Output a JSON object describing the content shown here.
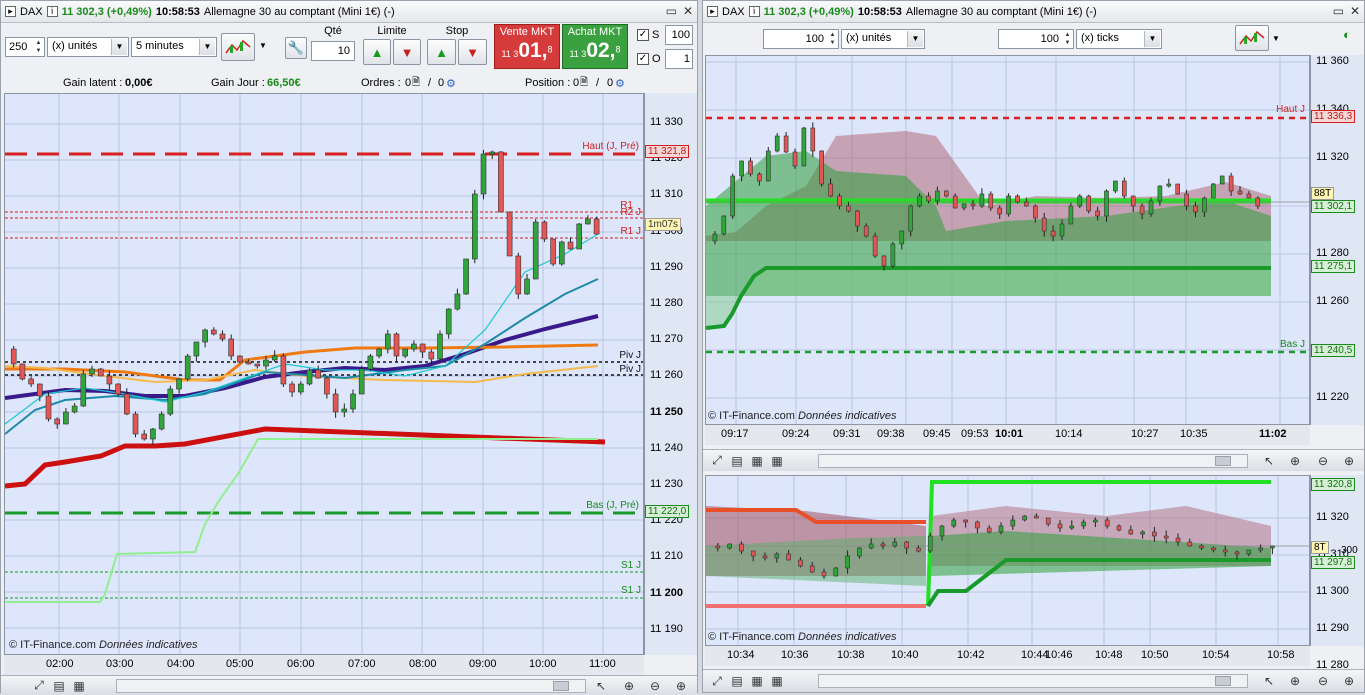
{
  "left": {
    "title": {
      "symbol": "DAX",
      "quote": "11 302,3 (+0,49%)",
      "time": "10:58:53",
      "instrument": "Allemagne 30 au comptant (Mini 1€) (-)"
    },
    "toolbar": {
      "qty_value": "250",
      "units_label": "(x) unités",
      "timeframe": "5 minutes",
      "qte_label": "Qté",
      "qte_value": "10",
      "limite_label": "Limite",
      "stop_label": "Stop",
      "vente_label": "Vente MKT",
      "vente_prefix": "11 3",
      "vente_big": "01,",
      "vente_sup": "8",
      "achat_label": "Achat MKT",
      "achat_prefix": "11 3",
      "achat_big": "02,",
      "achat_sup": "8",
      "s_label": "S",
      "s_value": "100",
      "o_label": "O",
      "o_value": "1"
    },
    "info": {
      "gain_latent_label": "Gain latent :",
      "gain_latent_value": "0,00€",
      "gain_jour_label": "Gain Jour :",
      "gain_jour_value": "66,50€",
      "ordres_label": "Ordres :",
      "ordres_a": "0",
      "ordres_b": "0",
      "position_label": "Position :",
      "position_a": "0",
      "position_b": "0"
    },
    "yaxis": [
      "11 330",
      "11 320",
      "11 310",
      "11 300",
      "11 290",
      "11 280",
      "11 270",
      "11 260",
      "11 250",
      "11 240",
      "11 230",
      "11 220",
      "11 210",
      "11 200",
      "11 190"
    ],
    "yaxis_bold": [
      "11 250",
      "11 200"
    ],
    "xaxis": [
      "02:00",
      "03:00",
      "04:00",
      "05:00",
      "06:00",
      "07:00",
      "08:00",
      "09:00",
      "10:00",
      "11:00"
    ],
    "levels": {
      "haut": "Haut (J, Pré)",
      "haut_price": "11 321,8",
      "r1a": "R1",
      "r2": "R2 J",
      "r1j": "R1 J",
      "countdown": "1m07s",
      "piv1": "Piv J",
      "piv2": "Piv J",
      "bas": "Bas (J, Pré)",
      "bas_price": "11 222,0",
      "s1a": "S1 J",
      "s1b": "S1 J"
    },
    "copyright": "© IT-Finance.com",
    "copyright_note": "Données indicatives"
  },
  "right": {
    "title": {
      "symbol": "DAX",
      "quote": "11 302,3 (+0,49%)",
      "time": "10:58:53",
      "instrument": "Allemagne 30 au comptant (Mini 1€) (-)"
    },
    "toolbar": {
      "qty1": "100",
      "units1": "(x) unités",
      "qty2": "100",
      "units2": "(x) ticks"
    },
    "top_chart": {
      "yaxis": [
        "11 360",
        "11 340",
        "11 320",
        "11 300",
        "11 280",
        "11 260",
        "11 240",
        "11 220"
      ],
      "xaxis": [
        "09:17",
        "09:24",
        "09:31",
        "09:38",
        "09:45",
        "09:53",
        "10:01",
        "10:14",
        "10:27",
        "10:35",
        "11:02"
      ],
      "xaxis_bold": [
        "10:01",
        "11:02"
      ],
      "haut": "Haut J",
      "haut_price": "11 336,3",
      "tag": "88T",
      "current_price": "11 302,1",
      "support_price": "11 275,1",
      "bas": "Bas J",
      "bas_price": "11 240,5"
    },
    "bottom_chart": {
      "yaxis": [
        "11 320",
        "11 310",
        "11 300",
        "11 290",
        "11 280"
      ],
      "xaxis": [
        "10:34",
        "10:36",
        "10:38",
        "10:40",
        "10:42",
        "10:44",
        "10:46",
        "10:48",
        "10:50",
        "10:54",
        "10:58"
      ],
      "top_price": "11 320,8",
      "tag": "8T",
      "current_partial": "300",
      "bottom_price": "11 297,8"
    },
    "copyright": "© IT-Finance.com",
    "copyright_note": "Données indicatives"
  },
  "colors": {
    "chart_bg": "#dde6fa",
    "bull": "#2f9e3a",
    "bear": "#d04848",
    "resistance": "#e0281e",
    "support": "#1f9a2a",
    "accent_green": "#22e022"
  }
}
